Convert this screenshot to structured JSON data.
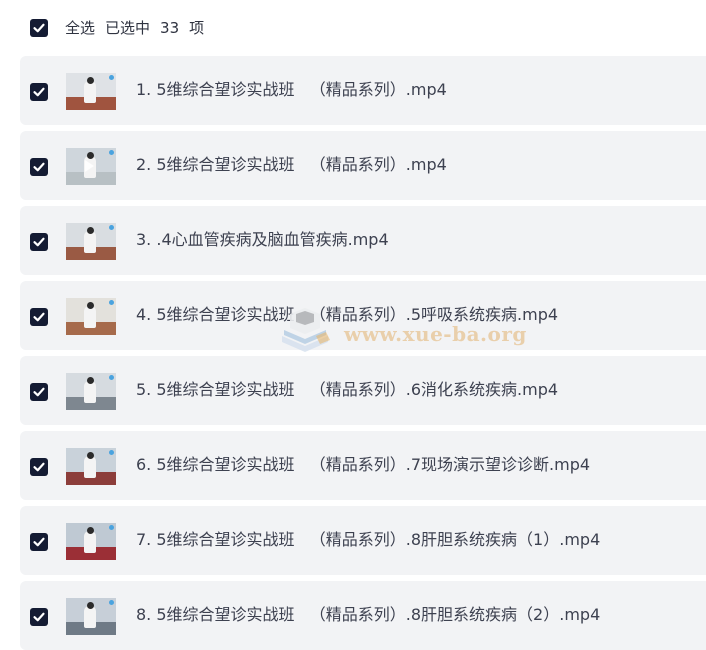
{
  "header": {
    "select_all_label": "全选",
    "selected_label": "已选中",
    "selected_count": "33",
    "unit_label": "项"
  },
  "files": [
    {
      "name": "1. 5维综合望诊实战班   （精品系列）.mp4",
      "checked": true
    },
    {
      "name": "2. 5维综合望诊实战班   （精品系列）.mp4",
      "checked": true
    },
    {
      "name": "3. .4心血管疾病及脑血管疾病.mp4",
      "checked": true
    },
    {
      "name": "4. 5维综合望诊实战班   （精品系列）.5呼吸系统疾病.mp4",
      "checked": true
    },
    {
      "name": "5. 5维综合望诊实战班   （精品系列）.6消化系统疾病.mp4",
      "checked": true
    },
    {
      "name": "6. 5维综合望诊实战班   （精品系列）.7现场演示望诊诊断.mp4",
      "checked": true
    },
    {
      "name": "7. 5维综合望诊实战班   （精品系列）.8肝胆系统疾病（1）.mp4",
      "checked": true
    },
    {
      "name": "8. 5维综合望诊实战班   （精品系列）.8肝胆系统疾病（2）.mp4",
      "checked": true
    }
  ],
  "watermark": {
    "text": "www.xue-ba.org"
  },
  "colors": {
    "checkbox": "#141b33",
    "row_bg": "#f2f3f5",
    "text": "#3d4150"
  }
}
